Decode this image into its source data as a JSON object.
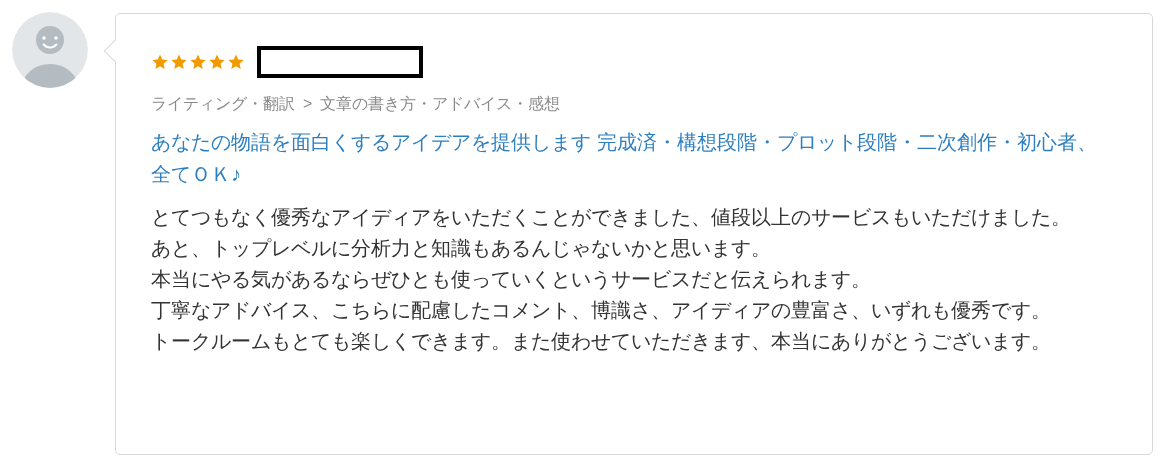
{
  "review": {
    "stars": 5,
    "category": [
      "ライティング・翻訳",
      ">",
      "文章の書き方・アドバイス・感想"
    ],
    "service_title": "あなたの物語を面白くするアイデアを提供します 完成済・構想段階・プロット段階・二次創作・初心者、全てＯＫ♪",
    "body": [
      "とてつもなく優秀なアイディアをいただくことができました、値段以上のサービスもいただけました。",
      "あと、トップレベルに分析力と知識もあるんじゃないかと思います。",
      "本当にやる気があるならぜひとも使っていくというサービスだと伝えられます。",
      "丁寧なアドバイス、こちらに配慮したコメント、博識さ、アイディアの豊富さ、いずれも優秀です。",
      "トークルームもとても楽しくできます。また使わせていただきます、本当にありがとうございます。"
    ]
  }
}
